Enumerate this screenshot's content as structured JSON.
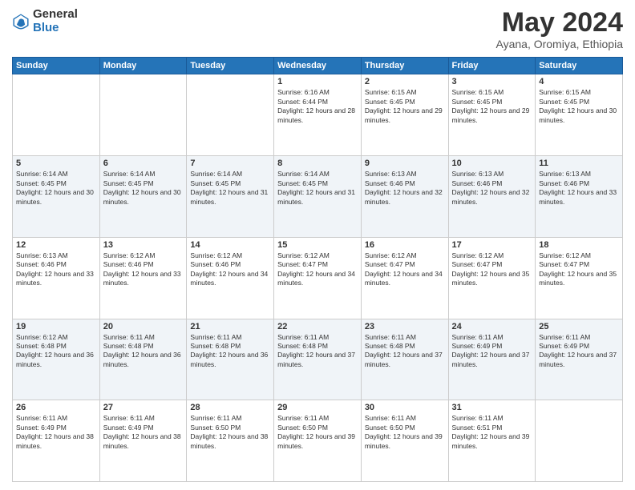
{
  "logo": {
    "general": "General",
    "blue": "Blue"
  },
  "header": {
    "month": "May 2024",
    "location": "Ayana, Oromiya, Ethiopia"
  },
  "weekdays": [
    "Sunday",
    "Monday",
    "Tuesday",
    "Wednesday",
    "Thursday",
    "Friday",
    "Saturday"
  ],
  "weeks": [
    [
      {
        "day": "",
        "sunrise": "",
        "sunset": "",
        "daylight": ""
      },
      {
        "day": "",
        "sunrise": "",
        "sunset": "",
        "daylight": ""
      },
      {
        "day": "",
        "sunrise": "",
        "sunset": "",
        "daylight": ""
      },
      {
        "day": "1",
        "sunrise": "Sunrise: 6:16 AM",
        "sunset": "Sunset: 6:44 PM",
        "daylight": "Daylight: 12 hours and 28 minutes."
      },
      {
        "day": "2",
        "sunrise": "Sunrise: 6:15 AM",
        "sunset": "Sunset: 6:45 PM",
        "daylight": "Daylight: 12 hours and 29 minutes."
      },
      {
        "day": "3",
        "sunrise": "Sunrise: 6:15 AM",
        "sunset": "Sunset: 6:45 PM",
        "daylight": "Daylight: 12 hours and 29 minutes."
      },
      {
        "day": "4",
        "sunrise": "Sunrise: 6:15 AM",
        "sunset": "Sunset: 6:45 PM",
        "daylight": "Daylight: 12 hours and 30 minutes."
      }
    ],
    [
      {
        "day": "5",
        "sunrise": "Sunrise: 6:14 AM",
        "sunset": "Sunset: 6:45 PM",
        "daylight": "Daylight: 12 hours and 30 minutes."
      },
      {
        "day": "6",
        "sunrise": "Sunrise: 6:14 AM",
        "sunset": "Sunset: 6:45 PM",
        "daylight": "Daylight: 12 hours and 30 minutes."
      },
      {
        "day": "7",
        "sunrise": "Sunrise: 6:14 AM",
        "sunset": "Sunset: 6:45 PM",
        "daylight": "Daylight: 12 hours and 31 minutes."
      },
      {
        "day": "8",
        "sunrise": "Sunrise: 6:14 AM",
        "sunset": "Sunset: 6:45 PM",
        "daylight": "Daylight: 12 hours and 31 minutes."
      },
      {
        "day": "9",
        "sunrise": "Sunrise: 6:13 AM",
        "sunset": "Sunset: 6:46 PM",
        "daylight": "Daylight: 12 hours and 32 minutes."
      },
      {
        "day": "10",
        "sunrise": "Sunrise: 6:13 AM",
        "sunset": "Sunset: 6:46 PM",
        "daylight": "Daylight: 12 hours and 32 minutes."
      },
      {
        "day": "11",
        "sunrise": "Sunrise: 6:13 AM",
        "sunset": "Sunset: 6:46 PM",
        "daylight": "Daylight: 12 hours and 33 minutes."
      }
    ],
    [
      {
        "day": "12",
        "sunrise": "Sunrise: 6:13 AM",
        "sunset": "Sunset: 6:46 PM",
        "daylight": "Daylight: 12 hours and 33 minutes."
      },
      {
        "day": "13",
        "sunrise": "Sunrise: 6:12 AM",
        "sunset": "Sunset: 6:46 PM",
        "daylight": "Daylight: 12 hours and 33 minutes."
      },
      {
        "day": "14",
        "sunrise": "Sunrise: 6:12 AM",
        "sunset": "Sunset: 6:46 PM",
        "daylight": "Daylight: 12 hours and 34 minutes."
      },
      {
        "day": "15",
        "sunrise": "Sunrise: 6:12 AM",
        "sunset": "Sunset: 6:47 PM",
        "daylight": "Daylight: 12 hours and 34 minutes."
      },
      {
        "day": "16",
        "sunrise": "Sunrise: 6:12 AM",
        "sunset": "Sunset: 6:47 PM",
        "daylight": "Daylight: 12 hours and 34 minutes."
      },
      {
        "day": "17",
        "sunrise": "Sunrise: 6:12 AM",
        "sunset": "Sunset: 6:47 PM",
        "daylight": "Daylight: 12 hours and 35 minutes."
      },
      {
        "day": "18",
        "sunrise": "Sunrise: 6:12 AM",
        "sunset": "Sunset: 6:47 PM",
        "daylight": "Daylight: 12 hours and 35 minutes."
      }
    ],
    [
      {
        "day": "19",
        "sunrise": "Sunrise: 6:12 AM",
        "sunset": "Sunset: 6:48 PM",
        "daylight": "Daylight: 12 hours and 36 minutes."
      },
      {
        "day": "20",
        "sunrise": "Sunrise: 6:11 AM",
        "sunset": "Sunset: 6:48 PM",
        "daylight": "Daylight: 12 hours and 36 minutes."
      },
      {
        "day": "21",
        "sunrise": "Sunrise: 6:11 AM",
        "sunset": "Sunset: 6:48 PM",
        "daylight": "Daylight: 12 hours and 36 minutes."
      },
      {
        "day": "22",
        "sunrise": "Sunrise: 6:11 AM",
        "sunset": "Sunset: 6:48 PM",
        "daylight": "Daylight: 12 hours and 37 minutes."
      },
      {
        "day": "23",
        "sunrise": "Sunrise: 6:11 AM",
        "sunset": "Sunset: 6:48 PM",
        "daylight": "Daylight: 12 hours and 37 minutes."
      },
      {
        "day": "24",
        "sunrise": "Sunrise: 6:11 AM",
        "sunset": "Sunset: 6:49 PM",
        "daylight": "Daylight: 12 hours and 37 minutes."
      },
      {
        "day": "25",
        "sunrise": "Sunrise: 6:11 AM",
        "sunset": "Sunset: 6:49 PM",
        "daylight": "Daylight: 12 hours and 37 minutes."
      }
    ],
    [
      {
        "day": "26",
        "sunrise": "Sunrise: 6:11 AM",
        "sunset": "Sunset: 6:49 PM",
        "daylight": "Daylight: 12 hours and 38 minutes."
      },
      {
        "day": "27",
        "sunrise": "Sunrise: 6:11 AM",
        "sunset": "Sunset: 6:49 PM",
        "daylight": "Daylight: 12 hours and 38 minutes."
      },
      {
        "day": "28",
        "sunrise": "Sunrise: 6:11 AM",
        "sunset": "Sunset: 6:50 PM",
        "daylight": "Daylight: 12 hours and 38 minutes."
      },
      {
        "day": "29",
        "sunrise": "Sunrise: 6:11 AM",
        "sunset": "Sunset: 6:50 PM",
        "daylight": "Daylight: 12 hours and 39 minutes."
      },
      {
        "day": "30",
        "sunrise": "Sunrise: 6:11 AM",
        "sunset": "Sunset: 6:50 PM",
        "daylight": "Daylight: 12 hours and 39 minutes."
      },
      {
        "day": "31",
        "sunrise": "Sunrise: 6:11 AM",
        "sunset": "Sunset: 6:51 PM",
        "daylight": "Daylight: 12 hours and 39 minutes."
      },
      {
        "day": "",
        "sunrise": "",
        "sunset": "",
        "daylight": ""
      }
    ]
  ]
}
